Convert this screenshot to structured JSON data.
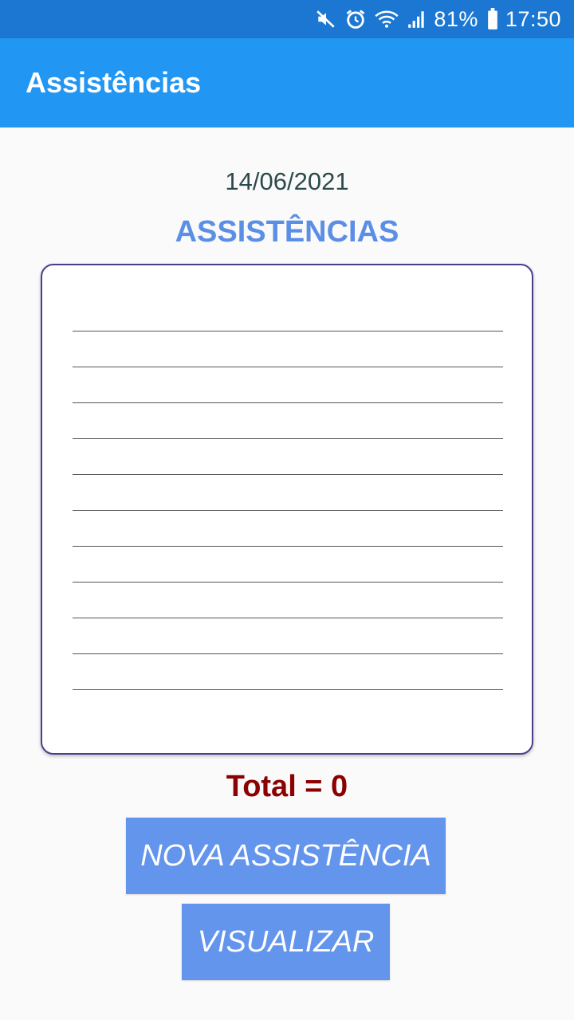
{
  "status_bar": {
    "battery_text": "81%",
    "time": "17:50",
    "icons": [
      "mute-icon",
      "alarm-icon",
      "wifi-icon",
      "signal-icon",
      "battery-icon"
    ]
  },
  "app_bar": {
    "title": "Assistências"
  },
  "main": {
    "date": "14/06/2021",
    "section_title": "ASSISTÊNCIAS",
    "list_rows": [
      "",
      "",
      "",
      "",
      "",
      "",
      "",
      "",
      "",
      "",
      ""
    ],
    "total_label": "Total = 0",
    "new_button_label": "NOVA ASSISTÊNCIA",
    "view_button_label": "VISUALIZAR"
  },
  "colors": {
    "status_bar": "#1b77d2",
    "app_bar": "#2196f3",
    "section_title": "#5b8fe6",
    "total": "#8b0000",
    "button": "#6495ed",
    "list_border": "#4a3f8c"
  }
}
